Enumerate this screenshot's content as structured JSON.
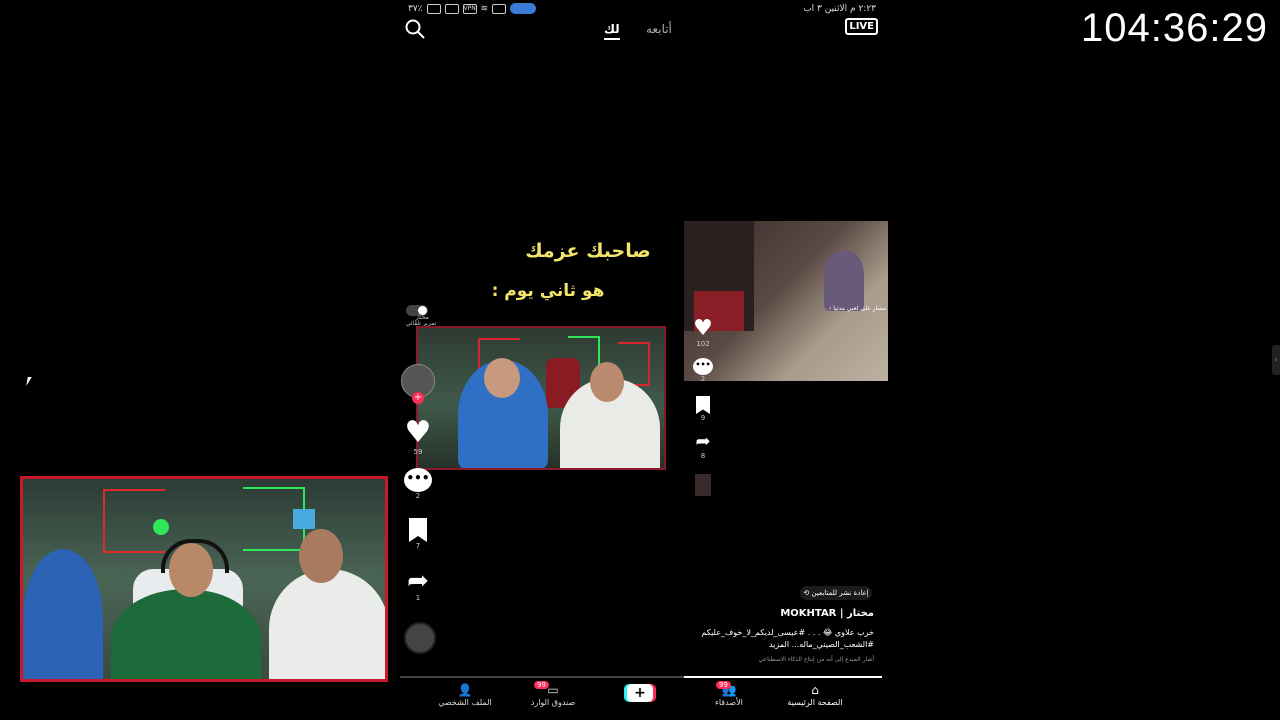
{
  "stream": {
    "timer": "104:36:29"
  },
  "status_bar": {
    "time_date": "٢:٢٣ م  الاثنين ٣ اب",
    "battery": "٣٧٪"
  },
  "top_nav": {
    "live_label": "LIVE",
    "tab_following": "أتابعه",
    "tab_for_you": "لك"
  },
  "post_left": {
    "caption_line1": "صاحبك عزمك",
    "caption_line2": "هو ثاني يوم :",
    "follow_label": "مختار",
    "auto_label": "تمرير تلقائي",
    "likes": "59",
    "comments": "2",
    "saves": "7",
    "shares": "1"
  },
  "post_right": {
    "likes": "102",
    "comments": "2",
    "saves": "9",
    "shares": "8",
    "overlay_label": "مسار على لعبي مدتيا ›"
  },
  "post_info": {
    "repost_label": "إعادة نشر للمتابعين",
    "author": "مختار | MOKHTAR",
    "description_line1": "خرب علاوي 😂 . . . #عيسى_لديكم_لا_خوف_عليكم",
    "description_line2": "#الشعب_الصيني_ماله... المزيد",
    "ai_notice": "أشار المبدع إلى أنه من إنتاج الذكاء الاصطناعي"
  },
  "progress": {
    "fraction": 0.41
  },
  "bottom_nav": {
    "home": "الصفحة الرئيسية",
    "friends": "الأصدقاء",
    "friends_badge": "99",
    "inbox": "صندوق الوارد",
    "inbox_badge": "99",
    "profile": "الملف الشخصي",
    "create": "+"
  },
  "colors": {
    "caption": "#f3e46a",
    "accent_red": "#fe2c55",
    "accent_cyan": "#25f4ee",
    "webcam_border": "#c8182b"
  }
}
